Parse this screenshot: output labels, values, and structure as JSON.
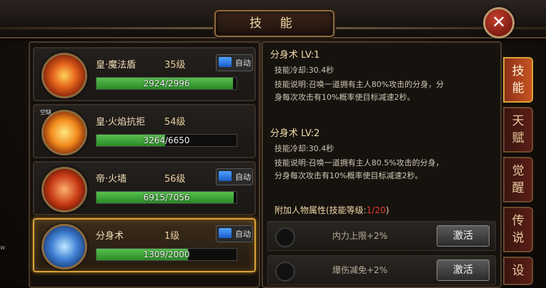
{
  "header": {
    "title": "技 能",
    "close_label": "✕"
  },
  "skills": [
    {
      "name": "皇·魔法盾",
      "level": "35级",
      "auto_label": "自动",
      "exp_text": "2924/2996",
      "exp_ratio": 0.976,
      "icon": "magic-shield-icon"
    },
    {
      "name": "皇·火焰抗拒",
      "level": "54级",
      "tag": "空缺",
      "exp_text": "3264/6650",
      "exp_ratio": 0.491,
      "icon": "flame-repel-icon"
    },
    {
      "name": "帝·火墙",
      "level": "56级",
      "auto_label": "自动",
      "exp_text": "6915/7056",
      "exp_ratio": 0.98,
      "icon": "fire-wall-icon"
    },
    {
      "name": "分身术",
      "level": "1级",
      "auto_label": "自动",
      "exp_text": "1309/2000",
      "exp_ratio": 0.6545,
      "icon": "clone-icon",
      "selected": true
    }
  ],
  "detail": {
    "lv1": {
      "header": "分身术   LV:1",
      "cooldown": "技能冷却:30.4秒",
      "desc_line1": "技能说明:召唤一道拥有主人80%攻击的分身，分",
      "desc_line2": "身每次攻击有10%概率使目标减速2秒。"
    },
    "lv2": {
      "header": "分身术   LV:2",
      "cooldown": "技能冷却:30.4秒",
      "desc_line1": "技能说明:召唤一道拥有主人80.5%攻击的分身，",
      "desc_line2": "分身每次攻击有10%概率使目标减速2秒。"
    },
    "attr_title_prefix": "附加人物属性(技能等级:",
    "attr_title_count": "1/20",
    "attr_title_suffix": ")",
    "attrs": [
      {
        "text": "内力上限+2%",
        "button": "激活"
      },
      {
        "text": "爆伤减免+2%",
        "button": "激活"
      }
    ]
  },
  "tabs": [
    {
      "line1": "技",
      "line2": "能",
      "active": true
    },
    {
      "line1": "天",
      "line2": "赋"
    },
    {
      "line1": "觉",
      "line2": "醒"
    },
    {
      "line1": "传",
      "line2": "说"
    },
    {
      "line1": "设",
      "line2": ""
    }
  ],
  "edge_mark": "w"
}
